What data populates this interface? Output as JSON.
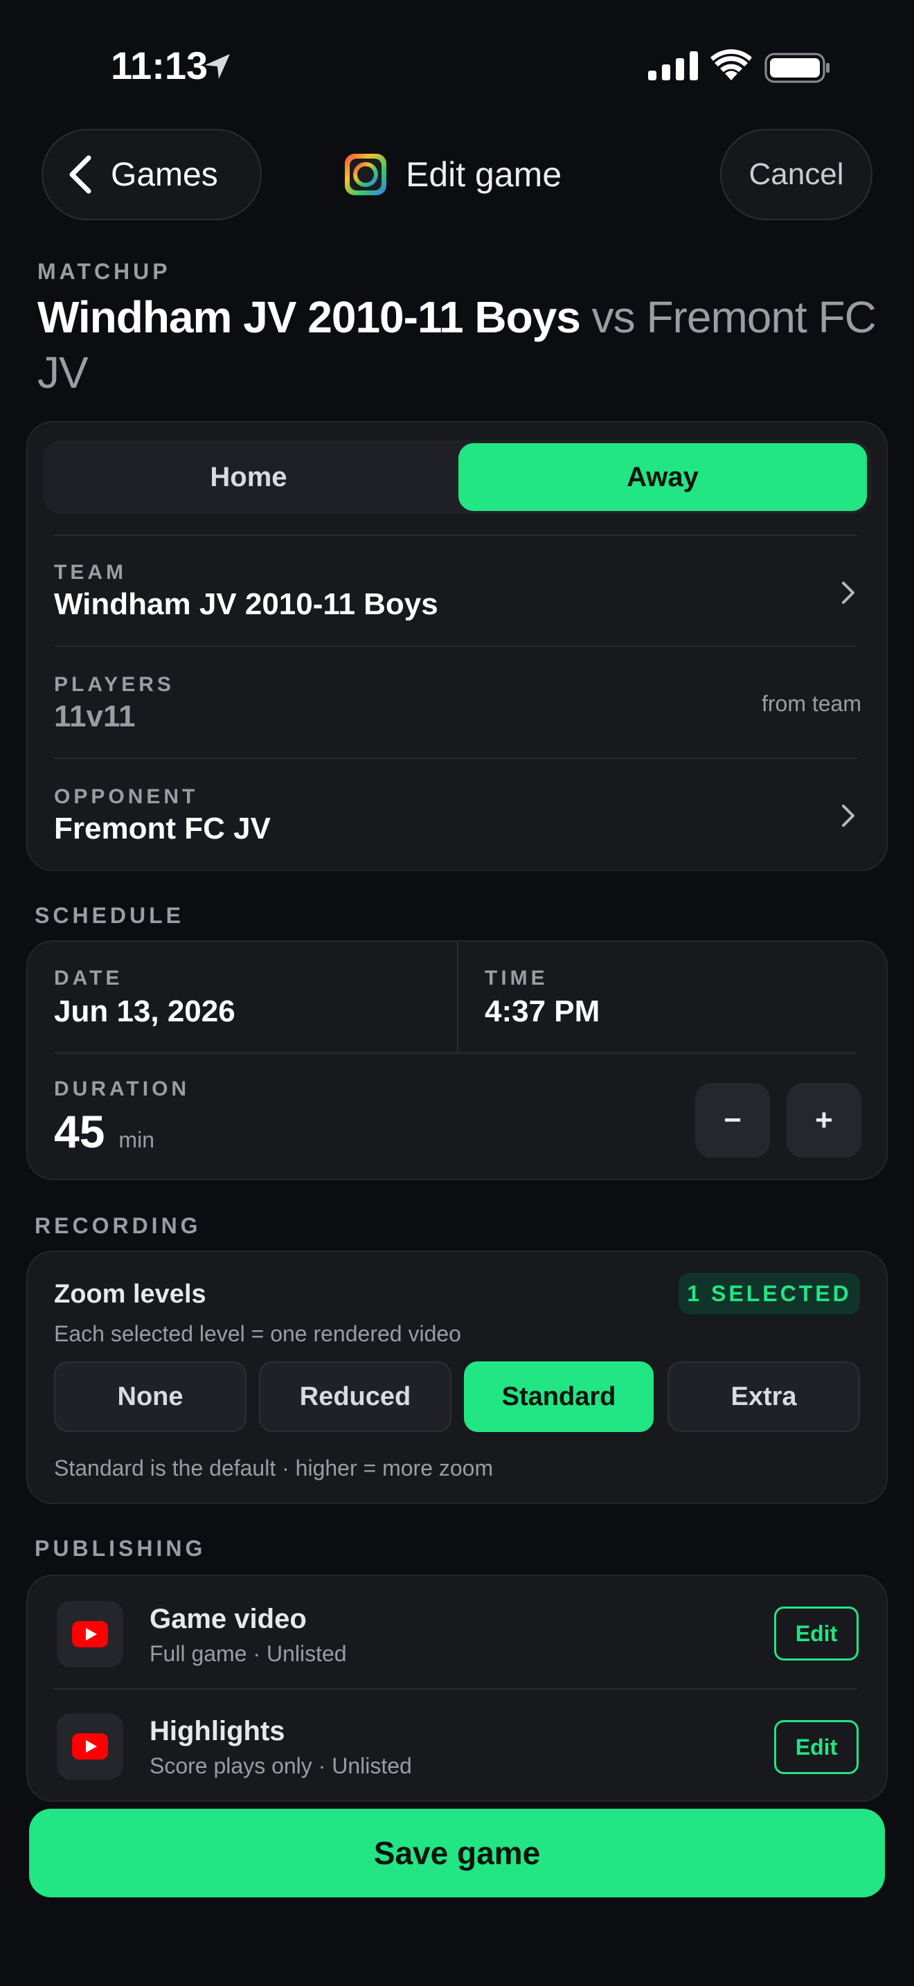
{
  "status_bar": {
    "time": "11:13"
  },
  "nav": {
    "back_label": "Games",
    "title": "Edit game",
    "cancel_label": "Cancel"
  },
  "matchup": {
    "section_label": "MATCHUP",
    "team": "Windham JV 2010-11 Boys",
    "vs": "vs",
    "opponent": "Fremont FC JV"
  },
  "venue": {
    "options": [
      "Home",
      "Away"
    ],
    "selected": "Away",
    "team_label": "TEAM",
    "team_value": "Windham JV 2010-11 Boys",
    "players_label": "PLAYERS",
    "players_value": "11v11",
    "players_hint": "from team",
    "opponent_label": "OPPONENT",
    "opponent_value": "Fremont FC JV"
  },
  "schedule": {
    "section_label": "SCHEDULE",
    "date_label": "DATE",
    "date_value": "Jun 13, 2026",
    "time_label": "TIME",
    "time_value": "4:37 PM",
    "duration_label": "DURATION",
    "duration_value": "45",
    "duration_unit": "min",
    "minus": "−",
    "plus": "+"
  },
  "recording": {
    "section_label": "RECORDING",
    "title": "Zoom levels",
    "badge": "1 SELECTED",
    "description": "Each selected level = one rendered video",
    "options": [
      "None",
      "Reduced",
      "Standard",
      "Extra"
    ],
    "selected": "Standard",
    "footnote": "Standard is the default · higher = more zoom"
  },
  "publishing": {
    "section_label": "PUBLISHING",
    "items": [
      {
        "title": "Game video",
        "subtitle": "Full game · Unlisted",
        "action": "Edit",
        "icon": "youtube-icon"
      },
      {
        "title": "Highlights",
        "subtitle": "Score plays only · Unlisted",
        "action": "Edit",
        "icon": "youtube-icon"
      }
    ]
  },
  "save_label": "Save game",
  "colors": {
    "accent": "#22e584",
    "background": "#0c0d10",
    "card": "#17191d",
    "youtube_red": "#ff0000"
  }
}
